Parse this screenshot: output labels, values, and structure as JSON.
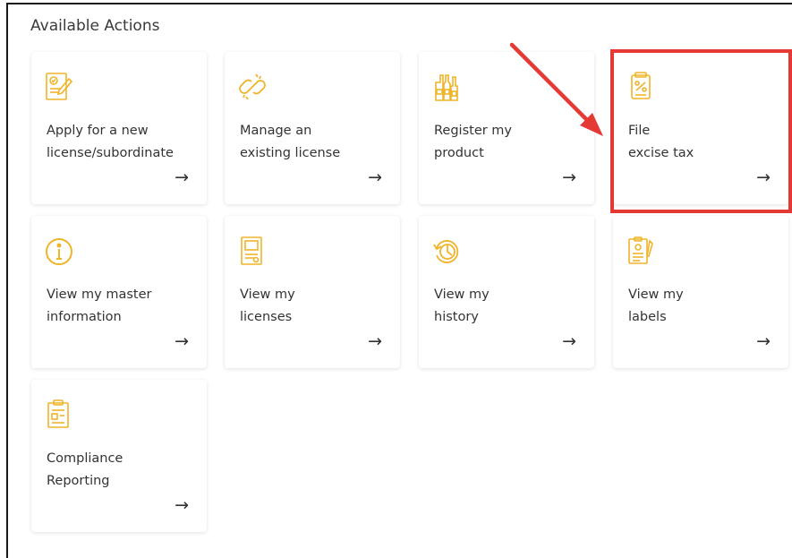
{
  "header": {
    "title": "Available Actions"
  },
  "actions": [
    {
      "line1": "Apply for a new",
      "line2": "license/subordinate",
      "icon": "license-application-icon"
    },
    {
      "line1": "Manage an",
      "line2": "existing license",
      "icon": "link-chain-icon"
    },
    {
      "line1": "Register my",
      "line2": "product",
      "icon": "bottles-icon"
    },
    {
      "line1": "File",
      "line2": "excise tax",
      "icon": "tax-document-icon"
    },
    {
      "line1": "View my master",
      "line2": "information",
      "icon": "info-icon"
    },
    {
      "line1": "View my",
      "line2": "licenses",
      "icon": "license-document-icon"
    },
    {
      "line1": "View my",
      "line2": "history",
      "icon": "history-clock-icon"
    },
    {
      "line1": "View my",
      "line2": "labels",
      "icon": "labels-icon"
    },
    {
      "line1": "Compliance",
      "line2": "Reporting",
      "icon": "compliance-report-icon"
    }
  ],
  "arrow_glyph": "→",
  "colors": {
    "icon": "#f0b429",
    "highlight": "#e53935",
    "text": "#333333"
  }
}
